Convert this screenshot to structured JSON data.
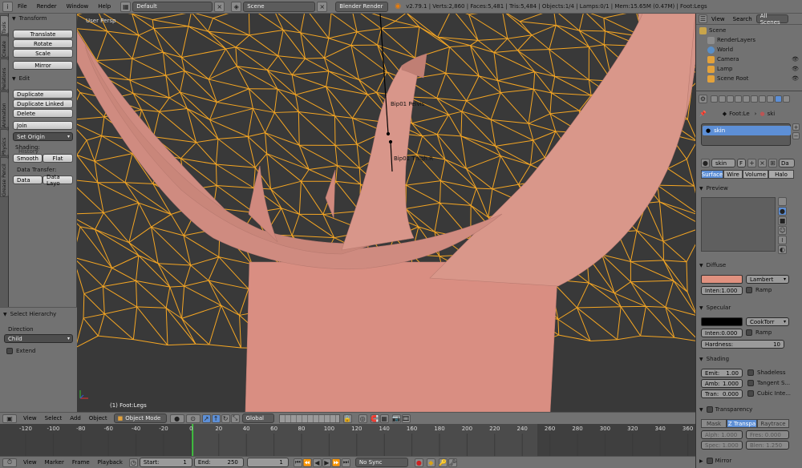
{
  "topbar": {
    "menus": [
      "File",
      "Render",
      "Window",
      "Help"
    ],
    "screen_layout": "Default",
    "scene": "Scene",
    "engine": "Blender Render",
    "stats": "v2.79.1 | Verts:2,860 | Faces:5,481 | Tris:5,484 | Objects:1/4 | Lamps:0/1 | Mem:15.65M (0.47M) | Foot:Legs"
  },
  "tool_tabs": [
    "Tools",
    "Create",
    "Relations",
    "Animation",
    "Physics",
    "Grease Pencil"
  ],
  "tool_shelf": {
    "transform_header": "Transform",
    "translate": "Translate",
    "rotate": "Rotate",
    "scale": "Scale",
    "mirror": "Mirror",
    "edit_header": "Edit",
    "duplicate": "Duplicate",
    "duplicate_linked": "Duplicate Linked",
    "delete": "Delete",
    "join": "Join",
    "set_origin": "Set Origin",
    "shading_label": "Shading:",
    "history_label": "History",
    "smooth": "Smooth",
    "flat": "Flat",
    "data_transfer_label": "Data Transfer:",
    "data": "Data",
    "data_layout": "Data Layo"
  },
  "operator_panel": {
    "header": "Select Hierarchy",
    "direction_label": "Direction",
    "direction_value": "Child",
    "extend_label": "Extend"
  },
  "viewport": {
    "view_label": "User Persp",
    "object_label": "(1) Foot:Legs",
    "bone1": "Bip01 Pelvis",
    "bone2": "Bip01 Thigh.R",
    "colors": {
      "background": "#393939",
      "wire": "#f5a623",
      "skin": "#d9958a"
    }
  },
  "outliner": {
    "view": "View",
    "search": "Search",
    "scope": "All Scenes",
    "items": [
      "Scene",
      "RenderLayers",
      "World",
      "Camera",
      "Lamp",
      "Scene Root"
    ]
  },
  "properties": {
    "breadcrumb_obj": "Foot:Le",
    "breadcrumb_mat": "ski",
    "material_slot": "skin",
    "material_name": "skin",
    "fake_user": "F",
    "data_dropdown": "Da",
    "tabs": [
      "Surface",
      "Wire",
      "Volume",
      "Halo"
    ],
    "preview_header": "Preview",
    "diffuse_header": "Diffuse",
    "diffuse_color": "#e0917f",
    "diffuse_shader": "Lambert",
    "diffuse_intensity": "Inten:1.000",
    "ramp": "Ramp",
    "specular_header": "Specular",
    "specular_color": "#000000",
    "specular_shader": "CookTorr",
    "specular_intensity": "Inten:0.000",
    "hardness_label": "Hardness:",
    "hardness_value": "10",
    "shading_header": "Shading",
    "emit": "Emit:",
    "emit_val": "1.00",
    "amb": "Amb:",
    "amb_val": "1.000",
    "tran": "Tran:",
    "tran_val": "0.000",
    "shadeless": "Shadeless",
    "tangent": "Tangent S...",
    "cubic": "Cubic Inte...",
    "transparency_header": "Transparency",
    "transp_tabs": [
      "Mask",
      "Z Transpa",
      "Raytrace"
    ],
    "alpha": "Alph: 1.000",
    "fresnel": "Fres: 0.000",
    "spec": "Spec: 1.000",
    "blend": "Blen: 1.250",
    "mirror_header": "Mirror"
  },
  "viewport_header": {
    "view": "View",
    "select": "Select",
    "add": "Add",
    "object": "Object",
    "mode": "Object Mode",
    "orientation": "Global"
  },
  "timeline": {
    "ticks": [
      "-120",
      "-100",
      "-80",
      "-60",
      "-40",
      "-20",
      "0",
      "20",
      "40",
      "60",
      "80",
      "100",
      "120",
      "140",
      "160",
      "180",
      "200",
      "220",
      "240",
      "260",
      "280",
      "300",
      "320",
      "340",
      "360"
    ],
    "current_frame": 1
  },
  "timeline_header": {
    "view": "View",
    "marker": "Marker",
    "frame": "Frame",
    "playback": "Playback",
    "start": "Start:",
    "start_val": "1",
    "end": "End:",
    "end_val": "250",
    "current": "1",
    "sync": "No Sync"
  }
}
